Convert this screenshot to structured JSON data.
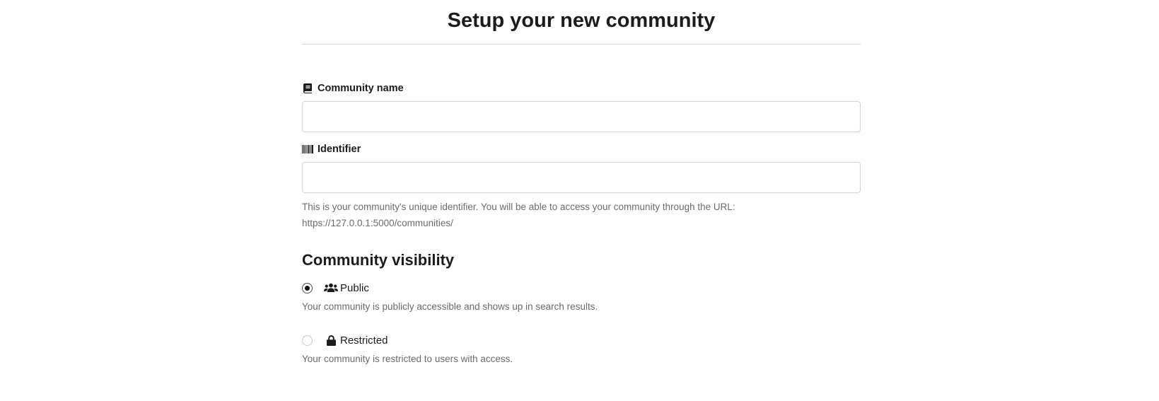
{
  "page": {
    "title": "Setup your new community"
  },
  "form": {
    "community_name": {
      "label": "Community name",
      "icon": "book-icon",
      "value": "",
      "placeholder": ""
    },
    "identifier": {
      "label": "Identifier",
      "icon": "barcode-icon",
      "value": "",
      "placeholder": "",
      "help_line1": "This is your community's unique identifier. You will be able to access your community through the URL:",
      "help_line2": "https://127.0.0.1:5000/communities/"
    },
    "visibility": {
      "heading": "Community visibility",
      "options": [
        {
          "label": "Public",
          "icon": "users-icon",
          "checked": true,
          "description": "Your community is publicly accessible and shows up in search results."
        },
        {
          "label": "Restricted",
          "icon": "lock-icon",
          "checked": false,
          "description": "Your community is restricted to users with access."
        }
      ]
    }
  },
  "colors": {
    "text": "#1b1c1d",
    "muted": "#6b6b6b",
    "border": "#d4d4d5"
  }
}
